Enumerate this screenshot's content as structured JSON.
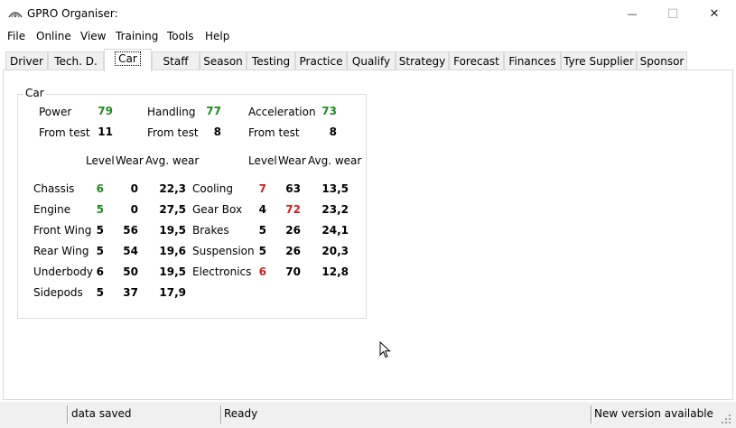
{
  "window": {
    "title": "GPRO Organiser:",
    "minimize_glyph": "—",
    "maximize_glyph": "☐",
    "close_glyph": "✕"
  },
  "menu": [
    "File",
    "Online",
    "View",
    "Training",
    "Tools",
    "Help"
  ],
  "tabs": [
    "Driver",
    "Tech. D.",
    "Car",
    "Staff",
    "Season",
    "Testing",
    "Practice",
    "Qualify",
    "Strategy",
    "Forecast",
    "Finances",
    "Tyre Supplier",
    "Sponsor"
  ],
  "active_tab": "Car",
  "colors": {
    "green": "#1f8b1f",
    "red": "#d21e1e"
  },
  "car": {
    "group_title": "Car",
    "stats": [
      {
        "label": "Power",
        "value": "79",
        "from_label": "From test",
        "from_value": "11"
      },
      {
        "label": "Handling",
        "value": "77",
        "from_label": "From test",
        "from_value": "8"
      },
      {
        "label": "Acceleration",
        "value": "73",
        "from_label": "From test",
        "from_value": "8"
      }
    ],
    "headers": {
      "level": "Level",
      "wear": "Wear",
      "avg_wear": "Avg. wear"
    },
    "left_parts": [
      {
        "name": "Chassis",
        "level": "6",
        "level_color": "green",
        "wear": "0",
        "wear_color": "",
        "avg": "22,3"
      },
      {
        "name": "Engine",
        "level": "5",
        "level_color": "green",
        "wear": "0",
        "wear_color": "",
        "avg": "27,5"
      },
      {
        "name": "Front Wing",
        "level": "5",
        "level_color": "",
        "wear": "56",
        "wear_color": "",
        "avg": "19,5"
      },
      {
        "name": "Rear Wing",
        "level": "5",
        "level_color": "",
        "wear": "54",
        "wear_color": "",
        "avg": "19,6"
      },
      {
        "name": "Underbody",
        "level": "6",
        "level_color": "",
        "wear": "50",
        "wear_color": "",
        "avg": "19,5"
      },
      {
        "name": "Sidepods",
        "level": "5",
        "level_color": "",
        "wear": "37",
        "wear_color": "",
        "avg": "17,9"
      }
    ],
    "right_parts": [
      {
        "name": "Cooling",
        "level": "7",
        "level_color": "red",
        "wear": "63",
        "wear_color": "",
        "avg": "13,5"
      },
      {
        "name": "Gear Box",
        "level": "4",
        "level_color": "",
        "wear": "72",
        "wear_color": "red",
        "avg": "23,2"
      },
      {
        "name": "Brakes",
        "level": "5",
        "level_color": "",
        "wear": "26",
        "wear_color": "",
        "avg": "24,1"
      },
      {
        "name": "Suspension",
        "level": "5",
        "level_color": "",
        "wear": "26",
        "wear_color": "",
        "avg": "20,3"
      },
      {
        "name": "Electronics",
        "level": "6",
        "level_color": "red",
        "wear": "70",
        "wear_color": "",
        "avg": "12,8"
      }
    ]
  },
  "status": {
    "left": "data saved",
    "middle": "Ready",
    "right": "New version available"
  }
}
